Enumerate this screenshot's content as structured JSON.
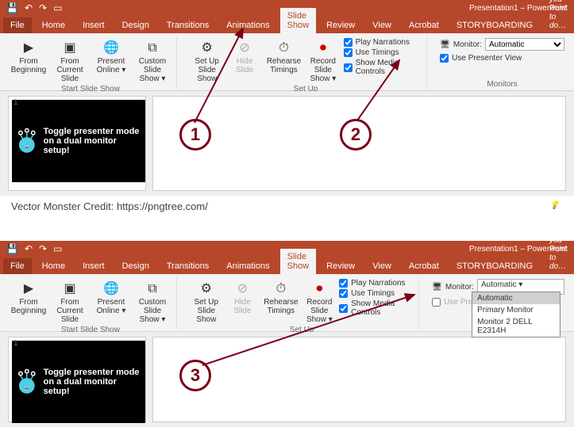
{
  "title": "Presentation1 – PowerPoint",
  "tabs": {
    "file": "File",
    "home": "Home",
    "insert": "Insert",
    "design": "Design",
    "transitions": "Transitions",
    "animations": "Animations",
    "slideshow": "Slide Show",
    "review": "Review",
    "view": "View",
    "acrobat": "Acrobat",
    "storyboarding": "STORYBOARDING"
  },
  "tell": "Tell me what you want to do…",
  "groups": {
    "start": {
      "label": "Start Slide Show",
      "fromBeginning": "From Beginning",
      "fromCurrent": "From Current Slide",
      "presentOnline": "Present Online ▾",
      "customShow": "Custom Slide Show ▾"
    },
    "setup": {
      "label": "Set Up",
      "setUpShow": "Set Up Slide Show",
      "hideSlide": "Hide Slide",
      "rehearse": "Rehearse Timings",
      "record": "Record Slide Show ▾",
      "playNarrations": "Play Narrations",
      "useTimings": "Use Timings",
      "showMedia": "Show Media Controls"
    },
    "monitors": {
      "label": "Monitors",
      "monitor": "Monitor:",
      "usePresenterView": "Use Presenter View",
      "selected": "Automatic",
      "options": [
        "Automatic",
        "Primary Monitor",
        "Monitor 2 DELL E2314H"
      ]
    }
  },
  "slide": {
    "number": "1",
    "text": "Toggle presenter mode on a dual monitor setup!"
  },
  "credit": "Vector Monster Credit: https://pngtree.com/",
  "circles": {
    "one": "1",
    "two": "2",
    "three": "3"
  },
  "chart_data": null
}
